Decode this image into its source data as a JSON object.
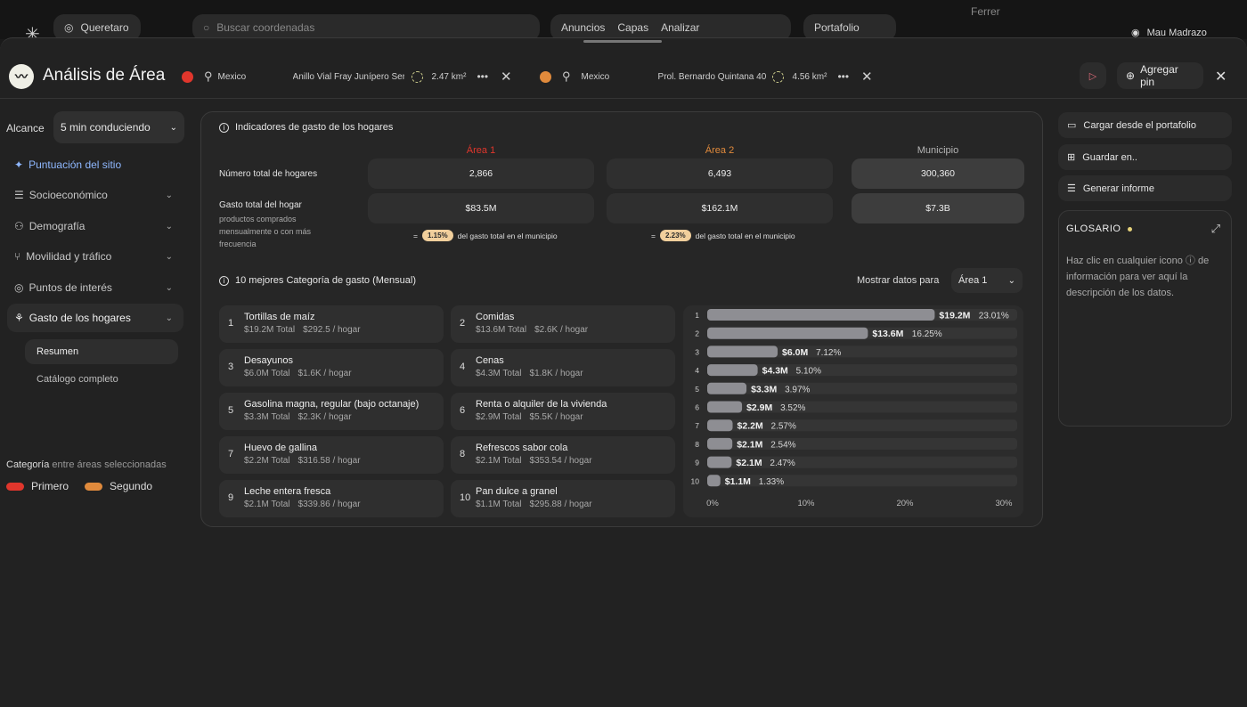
{
  "topbar": {
    "logo_icon": "snowflake-icon",
    "location": "Queretaro",
    "search_placeholder": "Buscar coordenadas",
    "tabs": [
      "Anuncios",
      "Capas",
      "Analizar",
      "Portafolio"
    ],
    "map_label": "Ferrer",
    "user": "Mau Madrazo"
  },
  "header": {
    "title": "Análisis de Área",
    "areas": [
      {
        "color": "#e0362c",
        "country": "Mexico",
        "address": "Anillo Vial Fray Junípero Serr",
        "size": "2.47 km²"
      },
      {
        "color": "#e08a3c",
        "country": "Mexico",
        "address": "Prol. Bernardo Quintana 40",
        "size": "4.56 km²"
      }
    ],
    "add_pin": "Agregar pin"
  },
  "sidebar": {
    "alcance_label": "Alcance",
    "alcance_value": "5 min conduciendo",
    "items": [
      {
        "label": "Puntuación del sitio",
        "icon": "sparkle-icon"
      },
      {
        "label": "Socioeconómico",
        "icon": "list-icon"
      },
      {
        "label": "Demografía",
        "icon": "people-icon"
      },
      {
        "label": "Movilidad y tráfico",
        "icon": "route-icon"
      },
      {
        "label": "Puntos de interés",
        "icon": "poi-icon"
      },
      {
        "label": "Gasto de los hogares",
        "icon": "money-icon"
      }
    ],
    "sub_items": [
      "Resumen",
      "Catálogo completo"
    ],
    "category_label_1": "Categoría",
    "category_label_2": " entre áreas seleccionadas",
    "legend": [
      {
        "label": "Primero",
        "color": "#e0362c"
      },
      {
        "label": "Segundo",
        "color": "#e08a3c"
      }
    ]
  },
  "indicators": {
    "title": "Indicadores de gasto de los hogares",
    "columns": [
      {
        "label": "Área 1",
        "color": "#e0362c"
      },
      {
        "label": "Área 2",
        "color": "#e08a3c"
      },
      {
        "label": "Municipio",
        "color": "#b5b5b5"
      }
    ],
    "row1_label": "Número total de hogares",
    "row1_values": [
      "2,866",
      "6,493",
      "300,360"
    ],
    "row2_label": "Gasto total del hogar",
    "row2_sub": "productos comprados mensualmente o con más frecuencia",
    "row2_values": [
      "$83.5M",
      "$162.1M",
      "$7.3B"
    ],
    "pct_notes": [
      {
        "prefix": "=",
        "badge": "1.15%",
        "text": "del gasto total en el municipio"
      },
      {
        "prefix": "=",
        "badge": "2.23%",
        "text": "del gasto total en el municipio"
      }
    ]
  },
  "top10": {
    "title": "10 mejores Categoría de gasto (Mensual)",
    "show_label": "Mostrar datos para",
    "show_value": "Área 1",
    "items": [
      {
        "rank": "1",
        "name": "Tortillas de maíz",
        "total": "$19.2M Total",
        "per": "$292.5 / hogar"
      },
      {
        "rank": "2",
        "name": "Comidas",
        "total": "$13.6M Total",
        "per": "$2.6K / hogar"
      },
      {
        "rank": "3",
        "name": "Desayunos",
        "total": "$6.0M Total",
        "per": "$1.6K / hogar"
      },
      {
        "rank": "4",
        "name": "Cenas",
        "total": "$4.3M Total",
        "per": "$1.8K / hogar"
      },
      {
        "rank": "5",
        "name": "Gasolina magna, regular (bajo octanaje)",
        "total": "$3.3M Total",
        "per": "$2.3K / hogar"
      },
      {
        "rank": "6",
        "name": "Renta o alquiler de la vivienda",
        "total": "$2.9M Total",
        "per": "$5.5K / hogar"
      },
      {
        "rank": "7",
        "name": "Huevo de gallina",
        "total": "$2.2M Total",
        "per": "$316.58 / hogar"
      },
      {
        "rank": "8",
        "name": "Refrescos sabor cola",
        "total": "$2.1M Total",
        "per": "$353.54 / hogar"
      },
      {
        "rank": "9",
        "name": "Leche entera fresca",
        "total": "$2.1M Total",
        "per": "$339.86 / hogar"
      },
      {
        "rank": "10",
        "name": "Pan dulce a granel",
        "total": "$1.1M Total",
        "per": "$295.88 / hogar"
      }
    ]
  },
  "chart_data": {
    "type": "bar",
    "orientation": "horizontal",
    "categories": [
      "1",
      "2",
      "3",
      "4",
      "5",
      "6",
      "7",
      "8",
      "9",
      "10"
    ],
    "values": [
      23.01,
      16.25,
      7.12,
      5.1,
      3.97,
      3.52,
      2.57,
      2.54,
      2.47,
      1.33
    ],
    "value_labels": [
      "$19.2M",
      "$13.6M",
      "$6.0M",
      "$4.3M",
      "$3.3M",
      "$2.9M",
      "$2.2M",
      "$2.1M",
      "$2.1M",
      "$1.1M"
    ],
    "pct_labels": [
      "23.01%",
      "16.25%",
      "7.12%",
      "5.10%",
      "3.97%",
      "3.52%",
      "2.57%",
      "2.54%",
      "2.47%",
      "1.33%"
    ],
    "xticks": [
      "0%",
      "10%",
      "20%",
      "30%"
    ],
    "xlim": [
      0,
      30
    ],
    "bar_color": "#8e8e93",
    "track_color": "#353535"
  },
  "right": {
    "buttons": [
      {
        "label": "Cargar desde el portafolio",
        "icon": "folder-icon"
      },
      {
        "label": "Guardar en..",
        "icon": "folder-plus-icon"
      },
      {
        "label": "Generar informe",
        "icon": "report-icon"
      }
    ],
    "glossary_title": "GLOSARIO",
    "glossary_text": "Haz clic en cualquier icono ⓘ de información para ver aquí la descripción de los datos."
  }
}
